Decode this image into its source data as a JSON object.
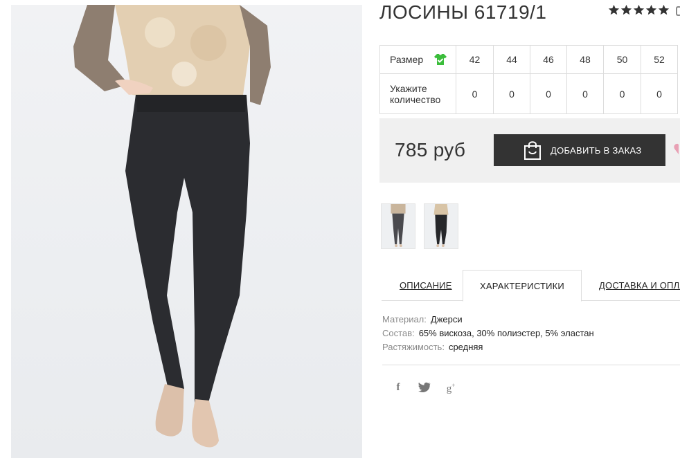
{
  "product": {
    "title": "ЛОСИНЫ 61719/1",
    "rating": 5
  },
  "sizes": {
    "size_label": "Размер",
    "quantity_label": "Укажите количество",
    "options": [
      {
        "size": "42",
        "qty": "0"
      },
      {
        "size": "44",
        "qty": "0"
      },
      {
        "size": "46",
        "qty": "0"
      },
      {
        "size": "48",
        "qty": "0"
      },
      {
        "size": "50",
        "qty": "0"
      },
      {
        "size": "52",
        "qty": "0"
      }
    ]
  },
  "purchase": {
    "price": "785 руб",
    "add_to_order_label": "ДОБАВИТЬ В ЗАКАЗ"
  },
  "tabs": [
    {
      "label": "ОПИСАНИЕ",
      "active": false
    },
    {
      "label": "ХАРАКТЕРИСТИКИ",
      "active": true
    },
    {
      "label": "ДОСТАВКА И ОПЛАТА",
      "active": false
    }
  ],
  "characteristics": [
    {
      "key": "Материал:",
      "value": "Джерси"
    },
    {
      "key": "Состав:",
      "value": "65% вискоза, 30% полиэстер, 5% эластан"
    },
    {
      "key": "Растяжимость:",
      "value": "средняя"
    }
  ],
  "social": [
    "facebook-icon",
    "twitter-icon",
    "google-plus-icon"
  ],
  "colors": {
    "button_bg": "#333333",
    "price_box_bg": "#f0f0f0",
    "size_icon_green": "#3bbd3b",
    "heart_pink": "#e8a0b4",
    "text_muted": "#8a8a8a"
  }
}
